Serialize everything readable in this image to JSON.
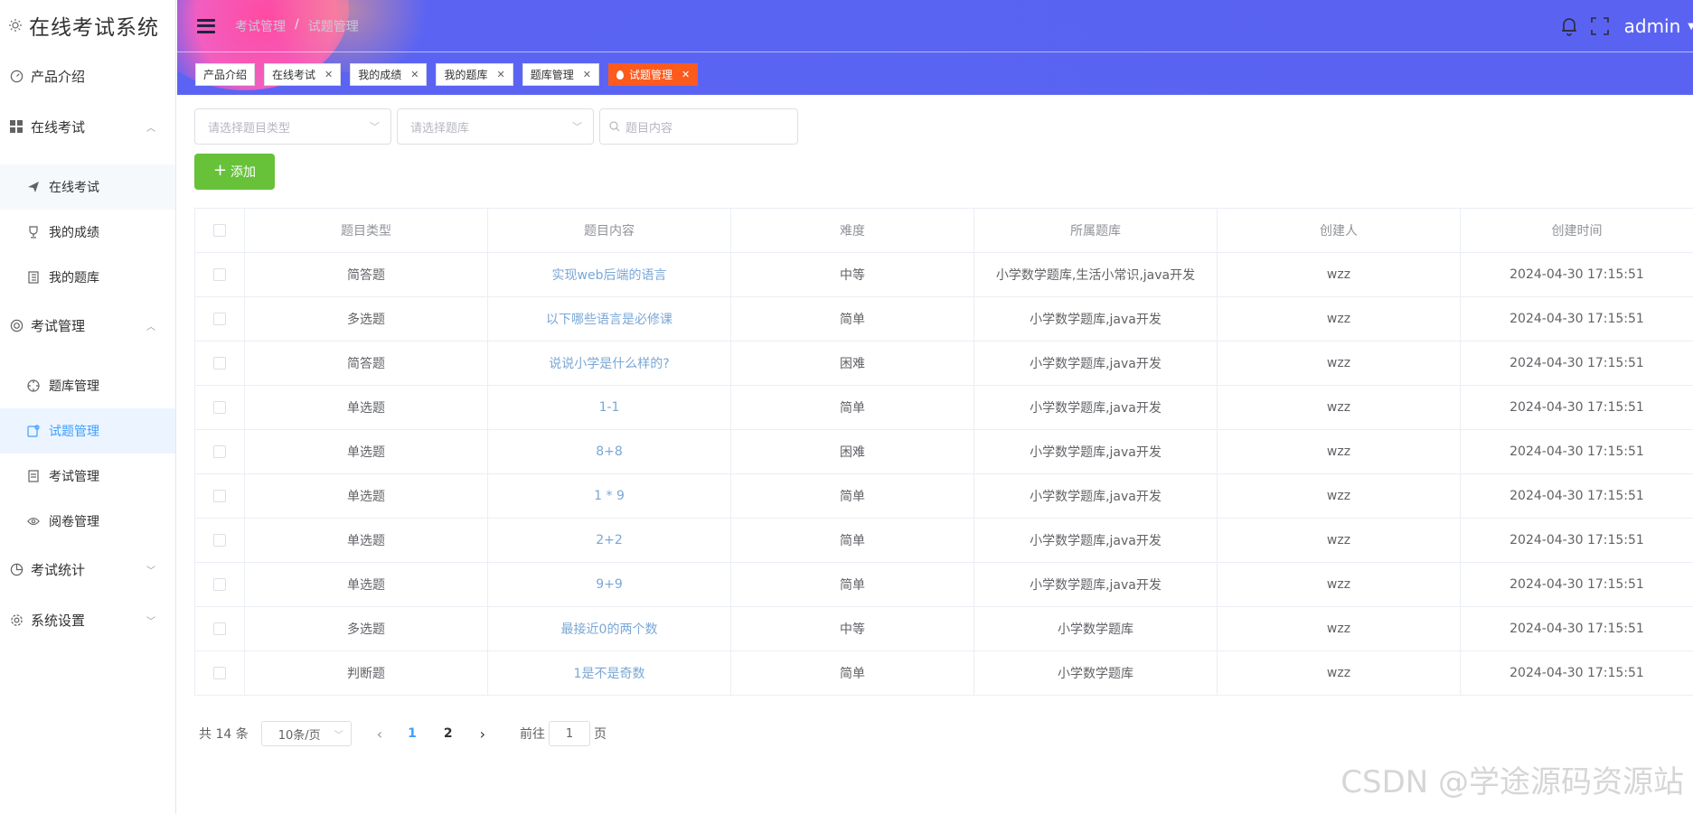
{
  "app": {
    "title": "在线考试系统"
  },
  "sidebar": {
    "items": [
      {
        "label": "产品介绍",
        "icon": "dashboard-icon"
      },
      {
        "label": "在线考试",
        "icon": "grid-icon",
        "expanded": true,
        "children": [
          {
            "label": "在线考试",
            "icon": "send-icon"
          },
          {
            "label": "我的成绩",
            "icon": "trophy-icon"
          },
          {
            "label": "我的题库",
            "icon": "notebook-icon"
          }
        ]
      },
      {
        "label": "考试管理",
        "icon": "lifebuoy-icon",
        "expanded": true,
        "children": [
          {
            "label": "题库管理",
            "icon": "target-icon"
          },
          {
            "label": "试题管理",
            "icon": "edit-doc-icon",
            "active": true
          },
          {
            "label": "考试管理",
            "icon": "document-icon"
          },
          {
            "label": "阅卷管理",
            "icon": "eye-icon"
          }
        ]
      },
      {
        "label": "考试统计",
        "icon": "pie-chart-icon",
        "expanded": false
      },
      {
        "label": "系统设置",
        "icon": "gear-icon",
        "expanded": false
      }
    ]
  },
  "header": {
    "breadcrumb": [
      "考试管理",
      "试题管理"
    ],
    "user": "admin",
    "tags": [
      {
        "label": "产品介绍",
        "closable": false
      },
      {
        "label": "在线考试",
        "closable": true
      },
      {
        "label": "我的成绩",
        "closable": true
      },
      {
        "label": "我的题库",
        "closable": true
      },
      {
        "label": "题库管理",
        "closable": true
      },
      {
        "label": "试题管理",
        "closable": true,
        "active": true
      }
    ]
  },
  "filters": {
    "type_placeholder": "请选择题目类型",
    "bank_placeholder": "请选择题库",
    "content_placeholder": "题目内容",
    "add_label": "添加"
  },
  "table": {
    "headers": [
      "题目类型",
      "题目内容",
      "难度",
      "所属题库",
      "创建人",
      "创建时间"
    ],
    "rows": [
      [
        "简答题",
        "实现web后端的语言",
        "中等",
        "小学数学题库,生活小常识,java开发",
        "wzz",
        "2024-04-30 17:15:51"
      ],
      [
        "多选题",
        "以下哪些语言是必修课",
        "简单",
        "小学数学题库,java开发",
        "wzz",
        "2024-04-30 17:15:51"
      ],
      [
        "简答题",
        "说说小学是什么样的?",
        "困难",
        "小学数学题库,java开发",
        "wzz",
        "2024-04-30 17:15:51"
      ],
      [
        "单选题",
        "1-1",
        "简单",
        "小学数学题库,java开发",
        "wzz",
        "2024-04-30 17:15:51"
      ],
      [
        "单选题",
        "8+8",
        "困难",
        "小学数学题库,java开发",
        "wzz",
        "2024-04-30 17:15:51"
      ],
      [
        "单选题",
        "1 * 9",
        "简单",
        "小学数学题库,java开发",
        "wzz",
        "2024-04-30 17:15:51"
      ],
      [
        "单选题",
        "2+2",
        "简单",
        "小学数学题库,java开发",
        "wzz",
        "2024-04-30 17:15:51"
      ],
      [
        "单选题",
        "9+9",
        "简单",
        "小学数学题库,java开发",
        "wzz",
        "2024-04-30 17:15:51"
      ],
      [
        "多选题",
        "最接近0的两个数",
        "中等",
        "小学数学题库",
        "wzz",
        "2024-04-30 17:15:51"
      ],
      [
        "判断题",
        "1是不是奇数",
        "简单",
        "小学数学题库",
        "wzz",
        "2024-04-30 17:15:51"
      ]
    ]
  },
  "pagination": {
    "total_text": "共 14 条",
    "page_size": "10条/页",
    "pages": [
      "1",
      "2"
    ],
    "current": "1",
    "goto_prefix": "前往",
    "goto_value": "1",
    "goto_suffix": "页"
  },
  "watermark": "CSDN @学途源码资源站",
  "colors": {
    "header": "#5b64f2",
    "active_tag": "#fd5a1e",
    "add_button": "#67c23a",
    "link": "#409eff"
  }
}
